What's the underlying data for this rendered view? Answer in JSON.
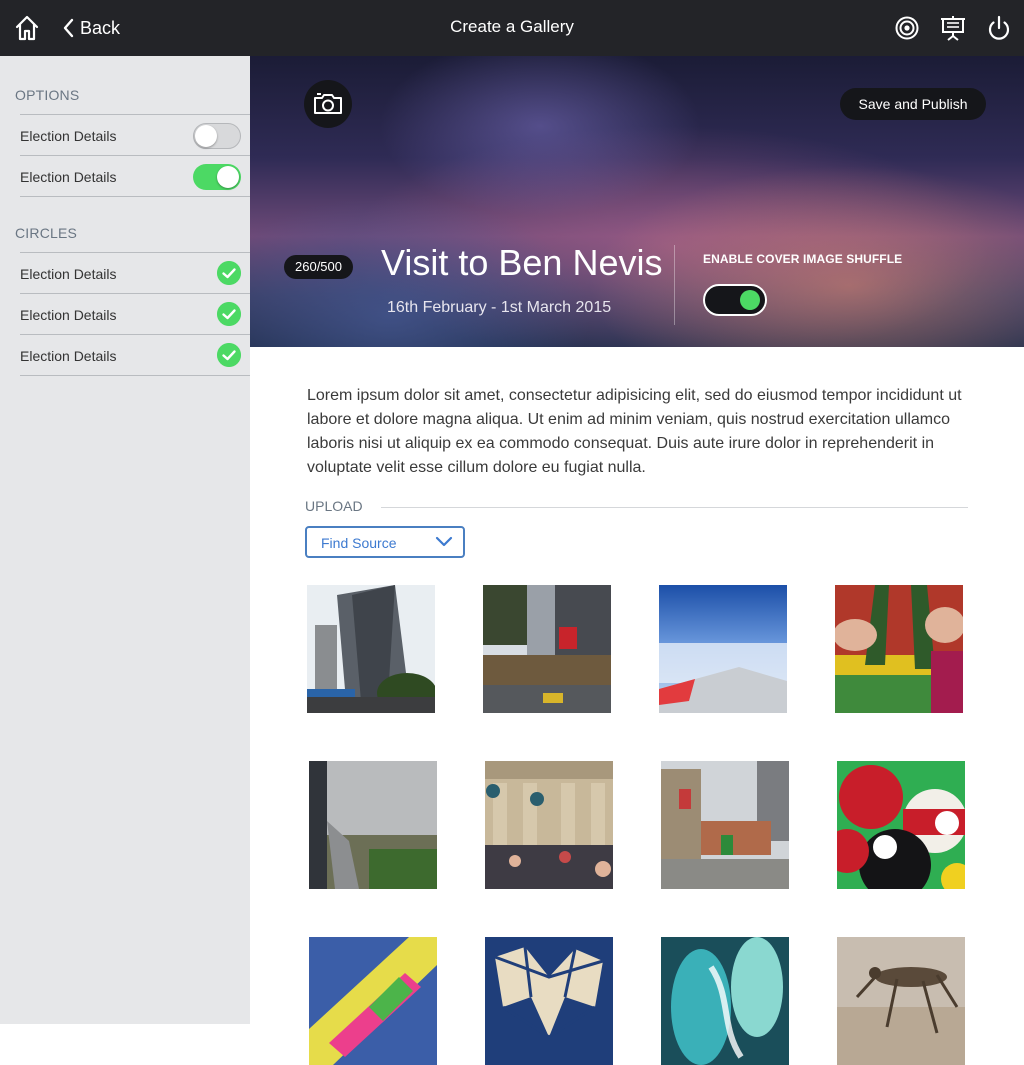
{
  "topbar": {
    "title": "Create a Gallery",
    "back_label": "Back",
    "icons": [
      "home-icon",
      "chevron-left-icon",
      "target-icon",
      "presentation-icon",
      "power-icon"
    ]
  },
  "sidebar": {
    "options_title": "OPTIONS",
    "options": [
      {
        "label": "Election Details",
        "enabled": false
      },
      {
        "label": "Election Details",
        "enabled": true
      }
    ],
    "circles_title": "CIRCLES",
    "circles": [
      {
        "label": "Election Details",
        "checked": true
      },
      {
        "label": "Election Details",
        "checked": true
      },
      {
        "label": "Election Details",
        "checked": true
      }
    ]
  },
  "hero": {
    "publish_label": "Save and Publish",
    "count": "260/500",
    "title": "Visit to Ben Nevis",
    "date": "16th February - 1st March 2015",
    "shuffle_label": "ENABLE COVER IMAGE SHUFFLE",
    "shuffle_enabled": true
  },
  "content": {
    "description": "Lorem ipsum dolor sit amet, consectetur adipisicing elit, sed do eiusmod tempor incididunt ut labore et dolore magna aliqua. Ut enim ad minim veniam, quis nostrud exercitation ullamco laboris nisi ut aliquip ex ea commodo consequat. Duis aute irure dolor in reprehenderit in voluptate velit esse cillum dolore eu fugiat nulla.",
    "upload_label": "UPLOAD",
    "source_select": "Find Source"
  },
  "gallery": [
    "city-towers-photo",
    "city-street-photo",
    "airplane-wing-photo",
    "beer-bottles-photo",
    "railway-path-photo",
    "station-crowd-photo",
    "city-square-photo",
    "billiard-balls-photo",
    "candy-roll-photo",
    "mosaic-tiles-photo",
    "glass-sculpture-photo",
    "grasshopper-photo"
  ],
  "colors": {
    "accent_green": "#4cd964",
    "topbar": "#232428",
    "sidebar": "#e6e7e9",
    "select_blue": "#3d7ad0"
  }
}
